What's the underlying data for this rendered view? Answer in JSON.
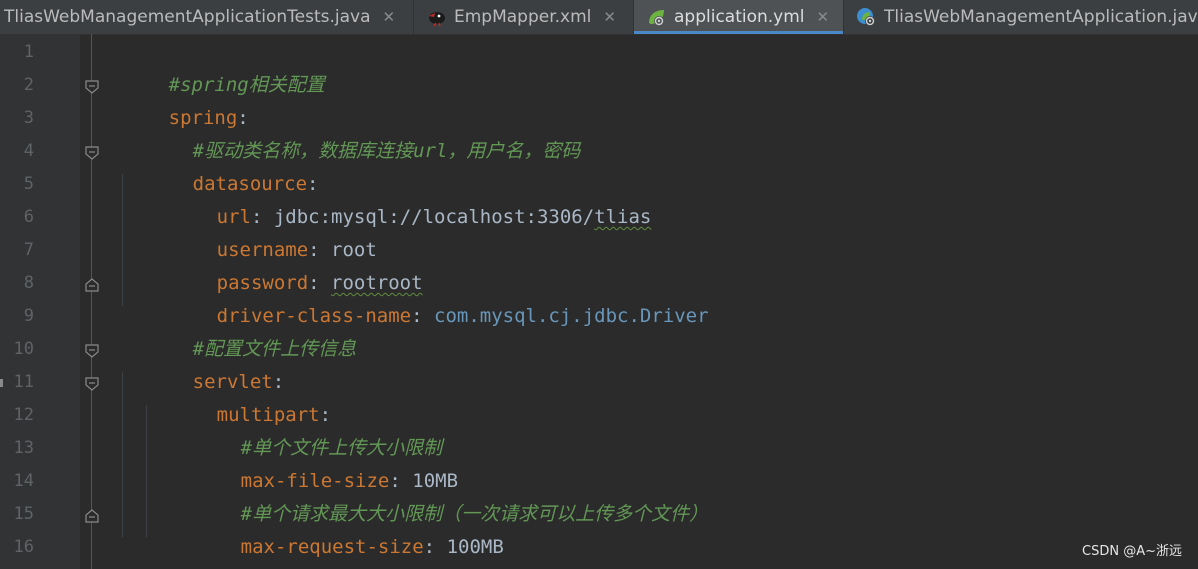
{
  "tabs": [
    {
      "label": "TliasWebManagementApplicationTests.java",
      "active": false,
      "icon": "java-test-icon"
    },
    {
      "label": "EmpMapper.xml",
      "active": false,
      "icon": "mybatis-bird-icon"
    },
    {
      "label": "application.yml",
      "active": true,
      "icon": "spring-yaml-icon"
    },
    {
      "label": "TliasWebManagementApplication.java",
      "active": false,
      "icon": "spring-java-icon"
    }
  ],
  "close_glyph": "✕",
  "line_numbers": [
    "1",
    "2",
    "3",
    "4",
    "5",
    "6",
    "7",
    "8",
    "9",
    "10",
    "11",
    "12",
    "13",
    "14",
    "15",
    "16"
  ],
  "code": {
    "l1": {
      "comment": "#spring相关配置"
    },
    "l2": {
      "key": "spring",
      "colon": ":"
    },
    "l3": {
      "comment": "#驱动类名称，数据库连接url，用户名，密码"
    },
    "l4": {
      "key": "datasource",
      "colon": ":"
    },
    "l5": {
      "key": "url",
      "colon": ": ",
      "value_a": "jdbc:mysql://localhost:3306/",
      "value_b": "tlias"
    },
    "l6": {
      "key": "username",
      "colon": ": ",
      "value": "root"
    },
    "l7": {
      "key": "password",
      "colon": ": ",
      "value": "rootroot"
    },
    "l8": {
      "key": "driver-class-name",
      "colon": ": ",
      "value": "com.mysql.cj.jdbc.Driver"
    },
    "l9": {
      "comment": "#配置文件上传信息"
    },
    "l10": {
      "key": "servlet",
      "colon": ":"
    },
    "l11": {
      "key": "multipart",
      "colon": ":"
    },
    "l12": {
      "comment": "#单个文件上传大小限制"
    },
    "l13": {
      "key": "max-file-size",
      "colon": ": ",
      "value": "10MB"
    },
    "l14": {
      "comment": "#单个请求最大大小限制（一次请求可以上传多个文件）"
    },
    "l15": {
      "key": "max-request-size",
      "colon": ": ",
      "value": "100MB"
    }
  },
  "watermark": "CSDN @A~浙远",
  "colors": {
    "key": "#cc7832",
    "comment": "#629755",
    "value": "#a9b7c6",
    "class_value": "#6897bb",
    "background": "#2b2b2b",
    "active_tab_underline": "#4a88c7"
  }
}
